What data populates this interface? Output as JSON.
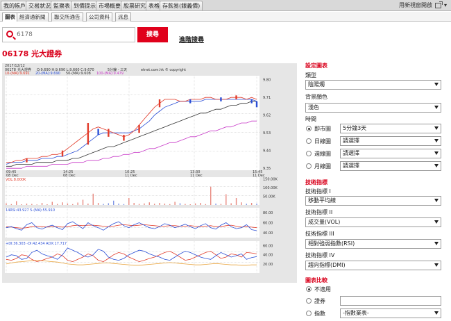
{
  "nav": {
    "tabs": [
      "我的帳戶",
      "交易狀況",
      "監察表",
      "到價提示",
      "市場概要",
      "股票研究",
      "表格",
      "存款易(銀義價)"
    ],
    "right_link": "用新視窗開啟",
    "icon": "external-window-icon"
  },
  "subnav": {
    "tabs": [
      "圖表",
      "經濟通新聞",
      "聯交所通告",
      "公司資料",
      "派息"
    ]
  },
  "search": {
    "placeholder": "6178",
    "button": "搜尋",
    "advanced": "進階搜尋"
  },
  "stock": {
    "title": "06178 光大證券"
  },
  "chart_data": {
    "type": "line",
    "header": {
      "date": "2017/12/12",
      "code": "06178",
      "name": "光大證券",
      "ohlc": "O:9.690 H:9.690 L:9.660 C:9.670",
      "interval": "5分鐘 - 三天",
      "source": "etnet.com.hk © copyright",
      "ma_legend": [
        "10-(MA):9.691",
        "20-(MA):9.690",
        "50-(MA):9.608",
        "100-(MA):9.479"
      ]
    },
    "colors": {
      "ma10": "#e23b2a",
      "ma20": "#2b4fd6",
      "ma50": "#333333",
      "ma100": "#c83ac8",
      "up": "#e23b2a",
      "down": "#2b4fd6"
    },
    "price_axis": {
      "ylim": [
        9.34,
        9.82
      ],
      "ticks": [
        "9.80",
        "9.71",
        "9.62",
        "9.53",
        "9.44",
        "9.35"
      ]
    },
    "x_ticks": [
      {
        "time": "09:45",
        "day": "08 Dec"
      },
      {
        "time": "14:25",
        "day": "08 Dec"
      },
      {
        "time": "10:25",
        "day": "11 Dec"
      },
      {
        "time": "13:30",
        "day": "11 Dec"
      },
      {
        "time": "15:45",
        "day": "11 Dec"
      }
    ],
    "ma10": [
      9.38,
      9.38,
      9.39,
      9.39,
      9.4,
      9.4,
      9.4,
      9.41,
      9.41,
      9.42,
      9.42,
      9.43,
      9.45,
      9.47,
      9.49,
      9.51,
      9.53,
      9.55,
      9.56,
      9.55,
      9.54,
      9.53,
      9.52,
      9.51,
      9.52,
      9.54,
      9.57,
      9.6,
      9.63,
      9.66,
      9.68,
      9.7,
      9.7,
      9.7,
      9.69,
      9.69,
      9.7,
      9.7,
      9.7,
      9.71,
      9.71,
      9.7,
      9.7,
      9.7,
      9.71,
      9.71,
      9.71,
      9.7,
      9.71,
      9.7
    ],
    "ma20": [
      9.37,
      9.38,
      9.38,
      9.38,
      9.39,
      9.39,
      9.39,
      9.4,
      9.4,
      9.4,
      9.41,
      9.41,
      9.42,
      9.43,
      9.44,
      9.46,
      9.48,
      9.5,
      9.52,
      9.53,
      9.53,
      9.53,
      9.53,
      9.53,
      9.53,
      9.54,
      9.55,
      9.57,
      9.59,
      9.62,
      9.64,
      9.66,
      9.67,
      9.68,
      9.69,
      9.69,
      9.69,
      9.69,
      9.69,
      9.7,
      9.7,
      9.7,
      9.7,
      9.7,
      9.7,
      9.7,
      9.7,
      9.7,
      9.7,
      9.69
    ],
    "ma50": [
      9.36,
      9.36,
      9.37,
      9.37,
      9.37,
      9.37,
      9.38,
      9.38,
      9.38,
      9.38,
      9.39,
      9.39,
      9.39,
      9.4,
      9.4,
      9.41,
      9.42,
      9.43,
      9.44,
      9.45,
      9.46,
      9.46,
      9.47,
      9.48,
      9.49,
      9.5,
      9.51,
      9.52,
      9.53,
      9.54,
      9.55,
      9.56,
      9.57,
      9.58,
      9.59,
      9.6,
      9.61,
      9.62,
      9.63,
      9.63,
      9.64,
      9.65,
      9.65,
      9.66,
      9.67,
      9.67,
      9.68,
      9.68,
      9.69,
      9.69
    ],
    "ma100": [
      9.35,
      9.35,
      9.35,
      9.35,
      9.36,
      9.36,
      9.36,
      9.36,
      9.36,
      9.37,
      9.37,
      9.37,
      9.37,
      9.38,
      9.38,
      9.38,
      9.39,
      9.39,
      9.39,
      9.4,
      9.4,
      9.41,
      9.41,
      9.42,
      9.42,
      9.43,
      9.43,
      9.44,
      9.45,
      9.45,
      9.46,
      9.47,
      9.48,
      9.48,
      9.49,
      9.5,
      9.51,
      9.51,
      9.52,
      9.53,
      9.54,
      9.54,
      9.55,
      9.56,
      9.56,
      9.57,
      9.58,
      9.58,
      9.59,
      9.59
    ],
    "candles": [
      {
        "i": 4,
        "o": 9.38,
        "c": 9.4
      },
      {
        "i": 11,
        "o": 9.41,
        "c": 9.44
      },
      {
        "i": 16,
        "o": 9.47,
        "c": 9.58
      },
      {
        "i": 18,
        "o": 9.55,
        "c": 9.52
      },
      {
        "i": 20,
        "o": 9.51,
        "c": 9.55
      },
      {
        "i": 23,
        "o": 9.49,
        "c": 9.52
      },
      {
        "i": 26,
        "o": 9.53,
        "c": 9.57
      },
      {
        "i": 30,
        "o": 9.66,
        "c": 9.7
      },
      {
        "i": 36,
        "o": 9.7,
        "c": 9.68
      },
      {
        "i": 42,
        "o": 9.71,
        "c": 9.69
      },
      {
        "i": 45,
        "o": 9.7,
        "c": 9.72
      },
      {
        "i": 48,
        "o": 9.7,
        "c": 9.68
      },
      {
        "i": 49,
        "o": 9.69,
        "c": 9.66
      }
    ],
    "volume": {
      "legend": "VOL:8.000K",
      "ticks": [
        "150.00K",
        "100.00K",
        "50.00K"
      ],
      "ylim": [
        0,
        160
      ],
      "values": [
        10,
        5,
        22,
        4,
        8,
        6,
        3,
        12,
        4,
        18,
        6,
        15,
        9,
        5,
        14,
        30,
        8,
        65,
        12,
        6,
        10,
        25,
        8,
        5,
        40,
        12,
        6,
        9,
        15,
        7,
        12,
        8,
        5,
        18,
        10,
        6,
        4,
        9,
        12,
        5,
        105,
        8,
        6,
        62,
        10,
        40,
        15,
        7,
        12,
        8
      ]
    },
    "rsi": {
      "legend": "14RSI:43.927 5-(MA):55.910",
      "ticks": [
        "80.00",
        "60.00",
        "40.00"
      ],
      "ylim": [
        30,
        90
      ],
      "rsi": [
        50,
        52,
        48,
        45,
        56,
        60,
        50,
        47,
        52,
        55,
        50,
        46,
        58,
        62,
        55,
        48,
        60,
        54,
        50,
        45,
        52,
        58,
        62,
        54,
        50,
        56,
        60,
        55,
        50,
        48,
        52,
        58,
        55,
        50,
        53,
        57,
        52,
        48,
        54,
        58,
        50,
        47,
        55,
        60,
        52,
        48,
        50,
        56,
        46,
        44
      ],
      "ma": [
        52,
        51,
        50,
        49,
        50,
        52,
        53,
        52,
        51,
        52,
        52,
        51,
        52,
        54,
        55,
        54,
        55,
        55,
        54,
        53,
        52,
        53,
        55,
        56,
        55,
        54,
        55,
        56,
        55,
        54,
        53,
        53,
        54,
        54,
        53,
        53,
        54,
        53,
        52,
        53,
        54,
        52,
        52,
        54,
        55,
        53,
        51,
        52,
        51,
        50
      ]
    },
    "dmi": {
      "legend": "+DI:36.303 -DI:42.434 ADX:17.717",
      "ticks": [
        "60.00",
        "40.00",
        "20.00"
      ],
      "ylim": [
        0,
        70
      ],
      "plus_di": [
        35,
        40,
        38,
        30,
        32,
        45,
        50,
        42,
        38,
        35,
        30,
        40,
        55,
        50,
        45,
        38,
        35,
        40,
        52,
        48,
        35,
        30,
        28,
        32,
        40,
        45,
        50,
        48,
        42,
        38,
        35,
        30,
        28,
        35,
        42,
        48,
        45,
        40,
        35,
        32,
        30,
        38,
        45,
        40,
        35,
        38,
        42,
        30,
        34,
        36
      ],
      "minus_di": [
        30,
        28,
        32,
        40,
        38,
        30,
        25,
        28,
        32,
        35,
        42,
        38,
        28,
        25,
        30,
        35,
        42,
        38,
        28,
        25,
        32,
        40,
        45,
        42,
        35,
        30,
        25,
        28,
        32,
        35,
        40,
        45,
        48,
        42,
        35,
        28,
        30,
        35,
        40,
        45,
        48,
        40,
        32,
        35,
        42,
        40,
        35,
        45,
        44,
        42
      ],
      "adx": [
        20,
        22,
        24,
        25,
        26,
        27,
        28,
        27,
        26,
        25,
        24,
        22,
        20,
        19,
        18,
        18,
        19,
        20,
        21,
        22,
        22,
        21,
        20,
        19,
        18,
        17,
        17,
        18,
        19,
        20,
        21,
        22,
        23,
        22,
        21,
        20,
        19,
        18,
        18,
        19,
        20,
        21,
        20,
        19,
        18,
        18,
        17,
        17,
        18,
        18
      ]
    }
  },
  "settings": {
    "section_chart": "設定圖表",
    "type_label": "類型",
    "type_value": "陰陽燭",
    "bg_label": "背景顏色",
    "bg_value": "淺色",
    "time_label": "時間",
    "intraday_label": "即市圖",
    "intraday_value": "5分鐘3天",
    "daily_label": "日線圖",
    "daily_value": "請選擇",
    "weekly_label": "週線圖",
    "weekly_value": "請選擇",
    "monthly_label": "月線圖",
    "monthly_value": "請選擇",
    "section_indicators": "技術指標",
    "ind1_label": "技術指標 I",
    "ind1_value": "移動平均線",
    "ind2_label": "技術指標 II",
    "ind2_value": "成交量(VOL)",
    "ind3_label": "技術指標 III",
    "ind3_value": "相對強弱指數(RSI)",
    "ind4_label": "技術指標 IV",
    "ind4_value": "趨向指標(DMI)",
    "section_compare": "圖表比較",
    "cmp_none": "不適用",
    "cmp_stock": "證券",
    "cmp_index": "指數",
    "cmp_index_value": "-指數業表-"
  }
}
